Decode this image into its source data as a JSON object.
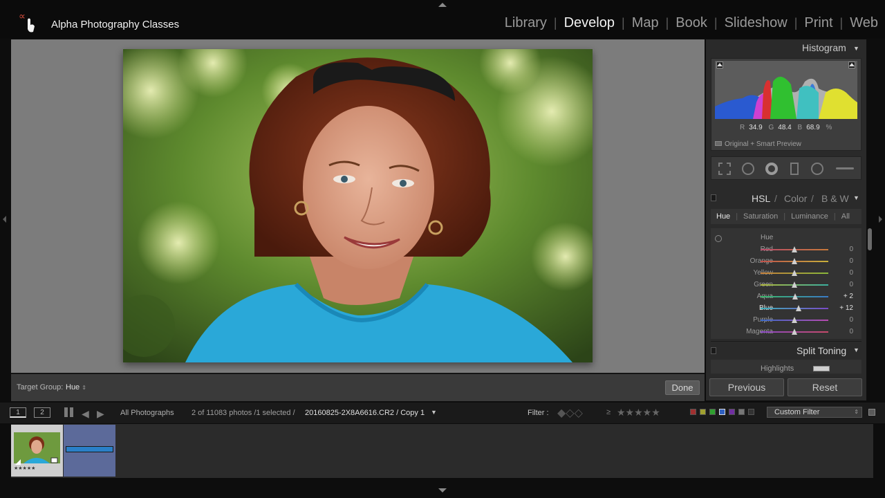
{
  "app": {
    "title": "Alpha Photography Classes"
  },
  "modules": [
    "Library",
    "Develop",
    "Map",
    "Book",
    "Slideshow",
    "Print",
    "Web"
  ],
  "active_module": "Develop",
  "toolbar": {
    "target_group_label": "Target Group:",
    "target_group_value": "Hue",
    "done_label": "Done"
  },
  "histogram": {
    "title": "Histogram",
    "r_label": "R",
    "r_value": "34.9",
    "g_label": "G",
    "g_value": "48.4",
    "b_label": "B",
    "b_value": "68.9",
    "unit": "%",
    "preview_label": "Original + Smart Preview"
  },
  "hsl": {
    "header_hsl": "HSL",
    "header_color": "Color",
    "header_bw": "B & W",
    "tabs": [
      "Hue",
      "Saturation",
      "Luminance",
      "All"
    ],
    "active_tab": "Hue",
    "section_label": "Hue",
    "sliders": [
      {
        "label": "Red",
        "value": "0",
        "pos": 0.5,
        "colors": [
          "#b94a6a",
          "#c87a3a"
        ]
      },
      {
        "label": "Orange",
        "value": "0",
        "pos": 0.5,
        "colors": [
          "#c0504a",
          "#c8b03a"
        ]
      },
      {
        "label": "Yellow",
        "value": "0",
        "pos": 0.5,
        "colors": [
          "#c8803a",
          "#8ab83a"
        ]
      },
      {
        "label": "Green",
        "value": "0",
        "pos": 0.5,
        "colors": [
          "#b0b83a",
          "#3ab0a0"
        ]
      },
      {
        "label": "Aqua",
        "value": "+ 2",
        "pos": 0.51,
        "colors": [
          "#3ab86a",
          "#3a7ac8"
        ]
      },
      {
        "label": "Blue",
        "value": "+ 12",
        "pos": 0.56,
        "colors": [
          "#3ab0b8",
          "#7a4ac8"
        ]
      },
      {
        "label": "Purple",
        "value": "0",
        "pos": 0.5,
        "colors": [
          "#3a6ac8",
          "#b84ab0"
        ]
      },
      {
        "label": "Magenta",
        "value": "0",
        "pos": 0.5,
        "colors": [
          "#8a4ac8",
          "#c84a6a"
        ]
      }
    ]
  },
  "split_toning": {
    "title": "Split Toning",
    "highlights_label": "Highlights"
  },
  "panel_buttons": {
    "previous": "Previous",
    "reset": "Reset"
  },
  "filmbar": {
    "view1": "1",
    "view2": "2",
    "source": "All Photographs",
    "count": "2 of 11083 photos /1 selected /",
    "filename": "20160825-2X8A6616.CR2 / Copy 1",
    "filter_label": "Filter :",
    "rating_op": "≥",
    "custom_filter": "Custom Filter"
  },
  "thumb": {
    "rating": "★★★★★"
  },
  "colors": {
    "accent": "#5c6a9a",
    "blue_bar": "#2a80c8"
  }
}
